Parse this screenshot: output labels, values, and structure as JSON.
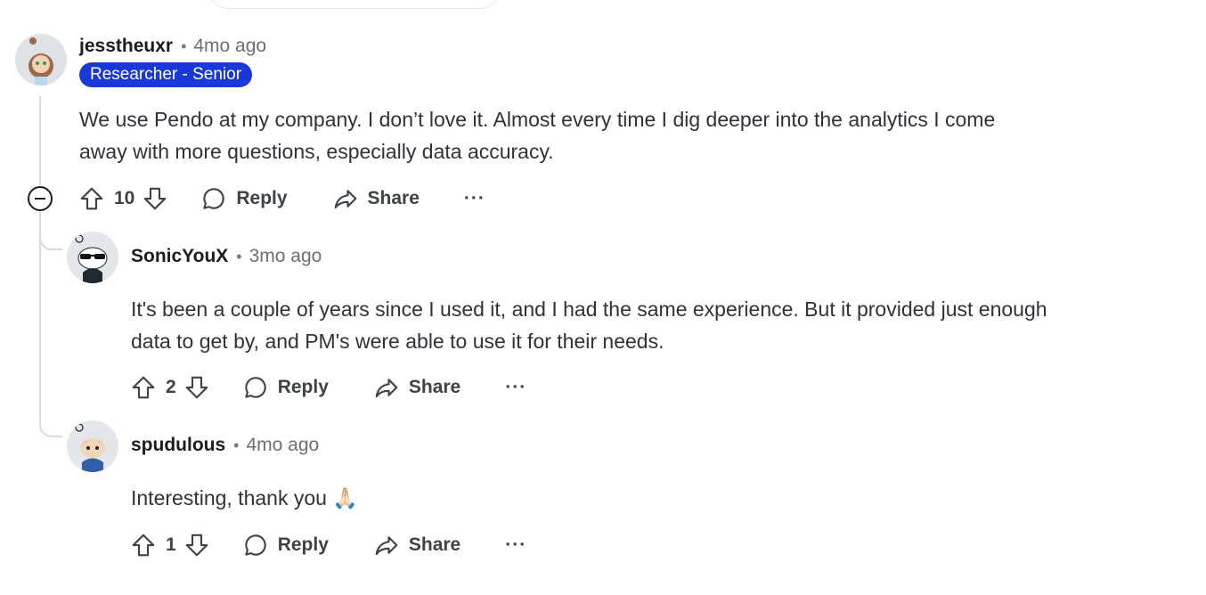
{
  "comments": [
    {
      "username": "jesstheuxr",
      "time": "4mo ago",
      "flair": "Researcher - Senior",
      "lines": [
        "We use Pendo at my company. I don’t love it. Almost every time I dig deeper into the analytics I come",
        "away with more questions, especially data accuracy."
      ],
      "votes": "10",
      "reply_label": "Reply",
      "share_label": "Share",
      "more_label": "···"
    },
    {
      "username": "SonicYouX",
      "time": "3mo ago",
      "lines": [
        "It's been a couple of years since I used it, and I had the same experience. But it provided just enough",
        "data to get by, and PM's were able to use it for their needs."
      ],
      "votes": "2",
      "reply_label": "Reply",
      "share_label": "Share",
      "more_label": "···"
    },
    {
      "username": "spudulous",
      "time": "4mo ago",
      "lines": [
        "Interesting, thank you 🙏🏻"
      ],
      "votes": "1",
      "reply_label": "Reply",
      "share_label": "Share",
      "more_label": "···"
    }
  ],
  "separator": "•",
  "colors": {
    "flair_bg": "#1a37d7",
    "thread_line": "#d7dbdf"
  }
}
